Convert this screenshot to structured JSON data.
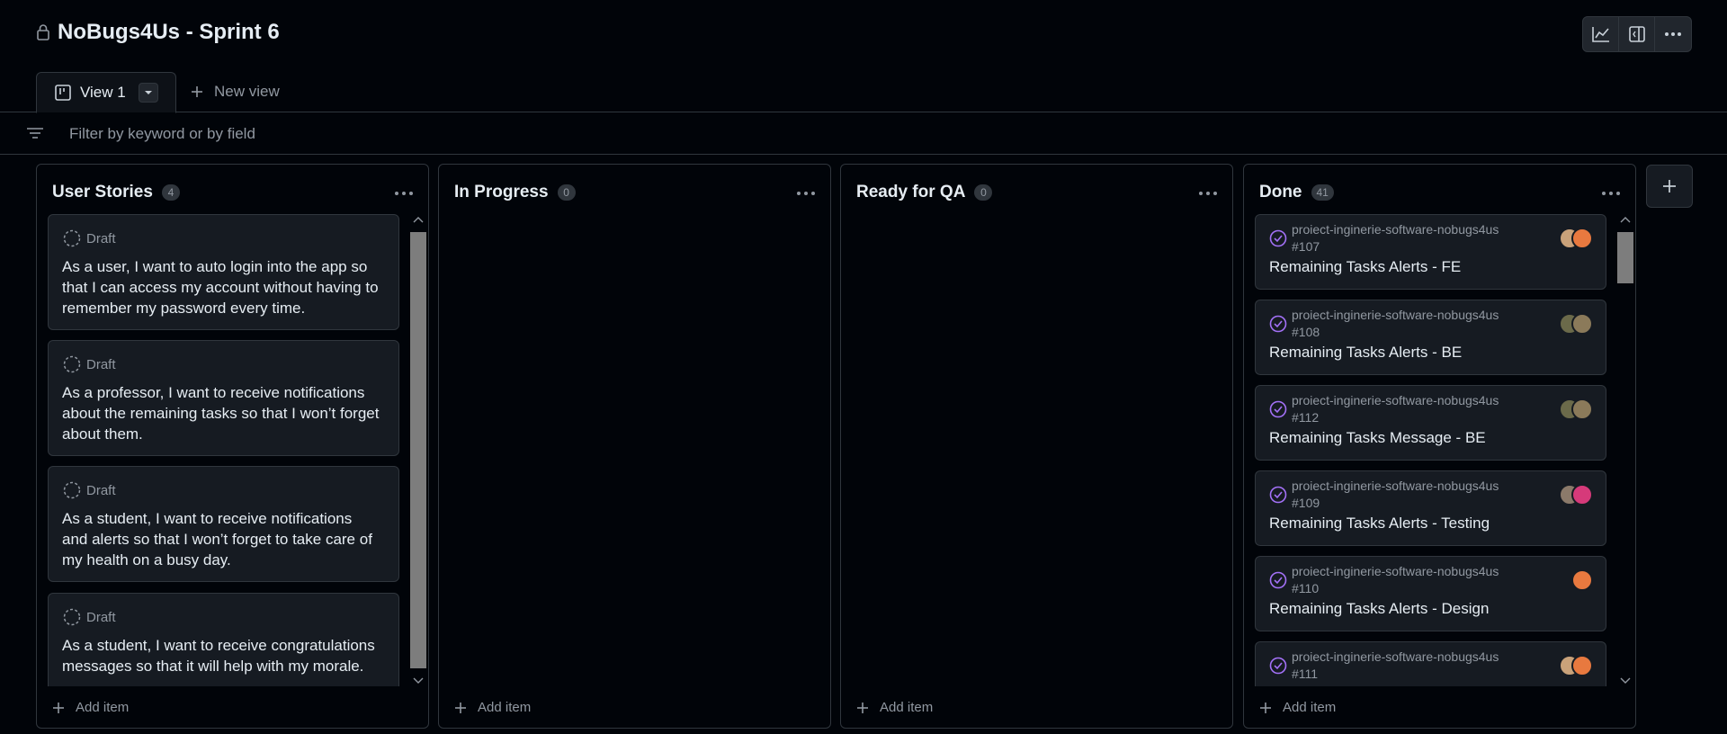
{
  "project": {
    "title": "NoBugs4Us - Sprint 6"
  },
  "top_actions": [
    {
      "name": "insights-icon"
    },
    {
      "name": "side-panel-icon"
    },
    {
      "name": "more-icon"
    }
  ],
  "tabs": {
    "active_label": "View 1",
    "new_view_label": "New view"
  },
  "filter": {
    "placeholder": "Filter by keyword or by field"
  },
  "columns": [
    {
      "title": "User Stories",
      "count": "4",
      "add_label": "Add item",
      "cards": [
        {
          "status": "Draft",
          "text": "As a user, I want to auto login into the app so that I can access my account without having to remember my password every time."
        },
        {
          "status": "Draft",
          "text": "As a professor, I want to receive notifications about the remaining tasks so that I won’t forget about them."
        },
        {
          "status": "Draft",
          "text": "As a student, I want to receive notifications and alerts so that I won’t forget to take care of my health on a busy day."
        },
        {
          "status": "Draft",
          "text": "As a student, I want to receive congratulations messages so that it will help with my morale."
        }
      ]
    },
    {
      "title": "In Progress",
      "count": "0",
      "add_label": "Add item",
      "cards": []
    },
    {
      "title": "Ready for QA",
      "count": "0",
      "add_label": "Add item",
      "cards": []
    },
    {
      "title": "Done",
      "count": "41",
      "add_label": "Add item",
      "cards": [
        {
          "repo": "proiect-inginerie-software-nobugs4us",
          "number": "#107",
          "title": "Remaining Tasks Alerts - FE"
        },
        {
          "repo": "proiect-inginerie-software-nobugs4us",
          "number": "#108",
          "title": "Remaining Tasks Alerts - BE"
        },
        {
          "repo": "proiect-inginerie-software-nobugs4us",
          "number": "#112",
          "title": "Remaining Tasks Message - BE"
        },
        {
          "repo": "proiect-inginerie-software-nobugs4us",
          "number": "#109",
          "title": "Remaining Tasks Alerts - Testing"
        },
        {
          "repo": "proiect-inginerie-software-nobugs4us",
          "number": "#110",
          "title": "Remaining Tasks Alerts - Design"
        },
        {
          "repo": "proiect-inginerie-software-nobugs4us",
          "number": "#111",
          "title": ""
        }
      ]
    }
  ],
  "colors": {
    "done_check": "#a371f7",
    "avatar_orange": "#e8793f",
    "avatar_photo": "#8b7a5a",
    "avatar_pink": "#d63a7a"
  }
}
